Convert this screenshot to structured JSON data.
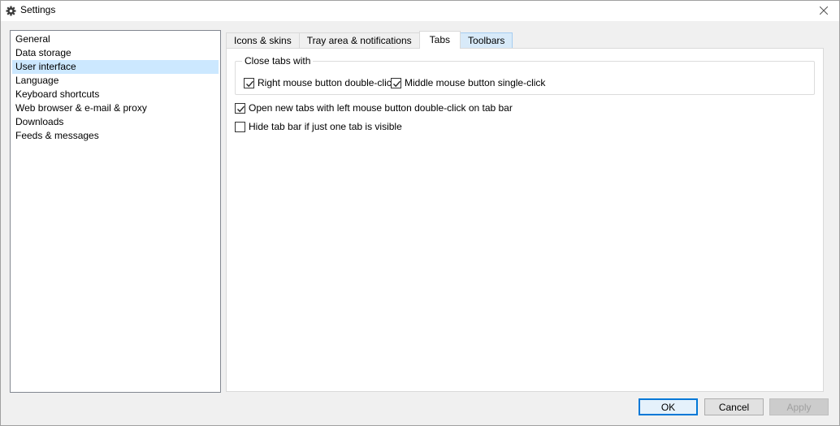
{
  "window": {
    "title": "Settings",
    "icon": "gear-icon",
    "close_icon": "close-icon"
  },
  "sidebar": {
    "items": [
      {
        "label": "General"
      },
      {
        "label": "Data storage"
      },
      {
        "label": "User interface",
        "selected": true
      },
      {
        "label": "Language"
      },
      {
        "label": "Keyboard shortcuts"
      },
      {
        "label": "Web browser & e-mail & proxy"
      },
      {
        "label": "Downloads"
      },
      {
        "label": "Feeds & messages"
      }
    ]
  },
  "tabs": [
    {
      "label": "Icons & skins"
    },
    {
      "label": "Tray area & notifications"
    },
    {
      "label": "Tabs",
      "active": true
    },
    {
      "label": "Toolbars"
    }
  ],
  "tab_content": {
    "close_group": {
      "title": "Close tabs with",
      "options": [
        {
          "label": "Right mouse button double-click",
          "checked": true
        },
        {
          "label": "Middle mouse button single-click",
          "checked": true
        }
      ]
    },
    "options": [
      {
        "label": "Open new tabs with left mouse button double-click on tab bar",
        "checked": true
      },
      {
        "label": "Hide tab bar if just one tab is visible",
        "checked": false
      }
    ]
  },
  "buttons": {
    "ok": "OK",
    "cancel": "Cancel",
    "apply": "Apply"
  },
  "colors": {
    "selection": "#cce8ff",
    "accent": "#0078d7"
  }
}
